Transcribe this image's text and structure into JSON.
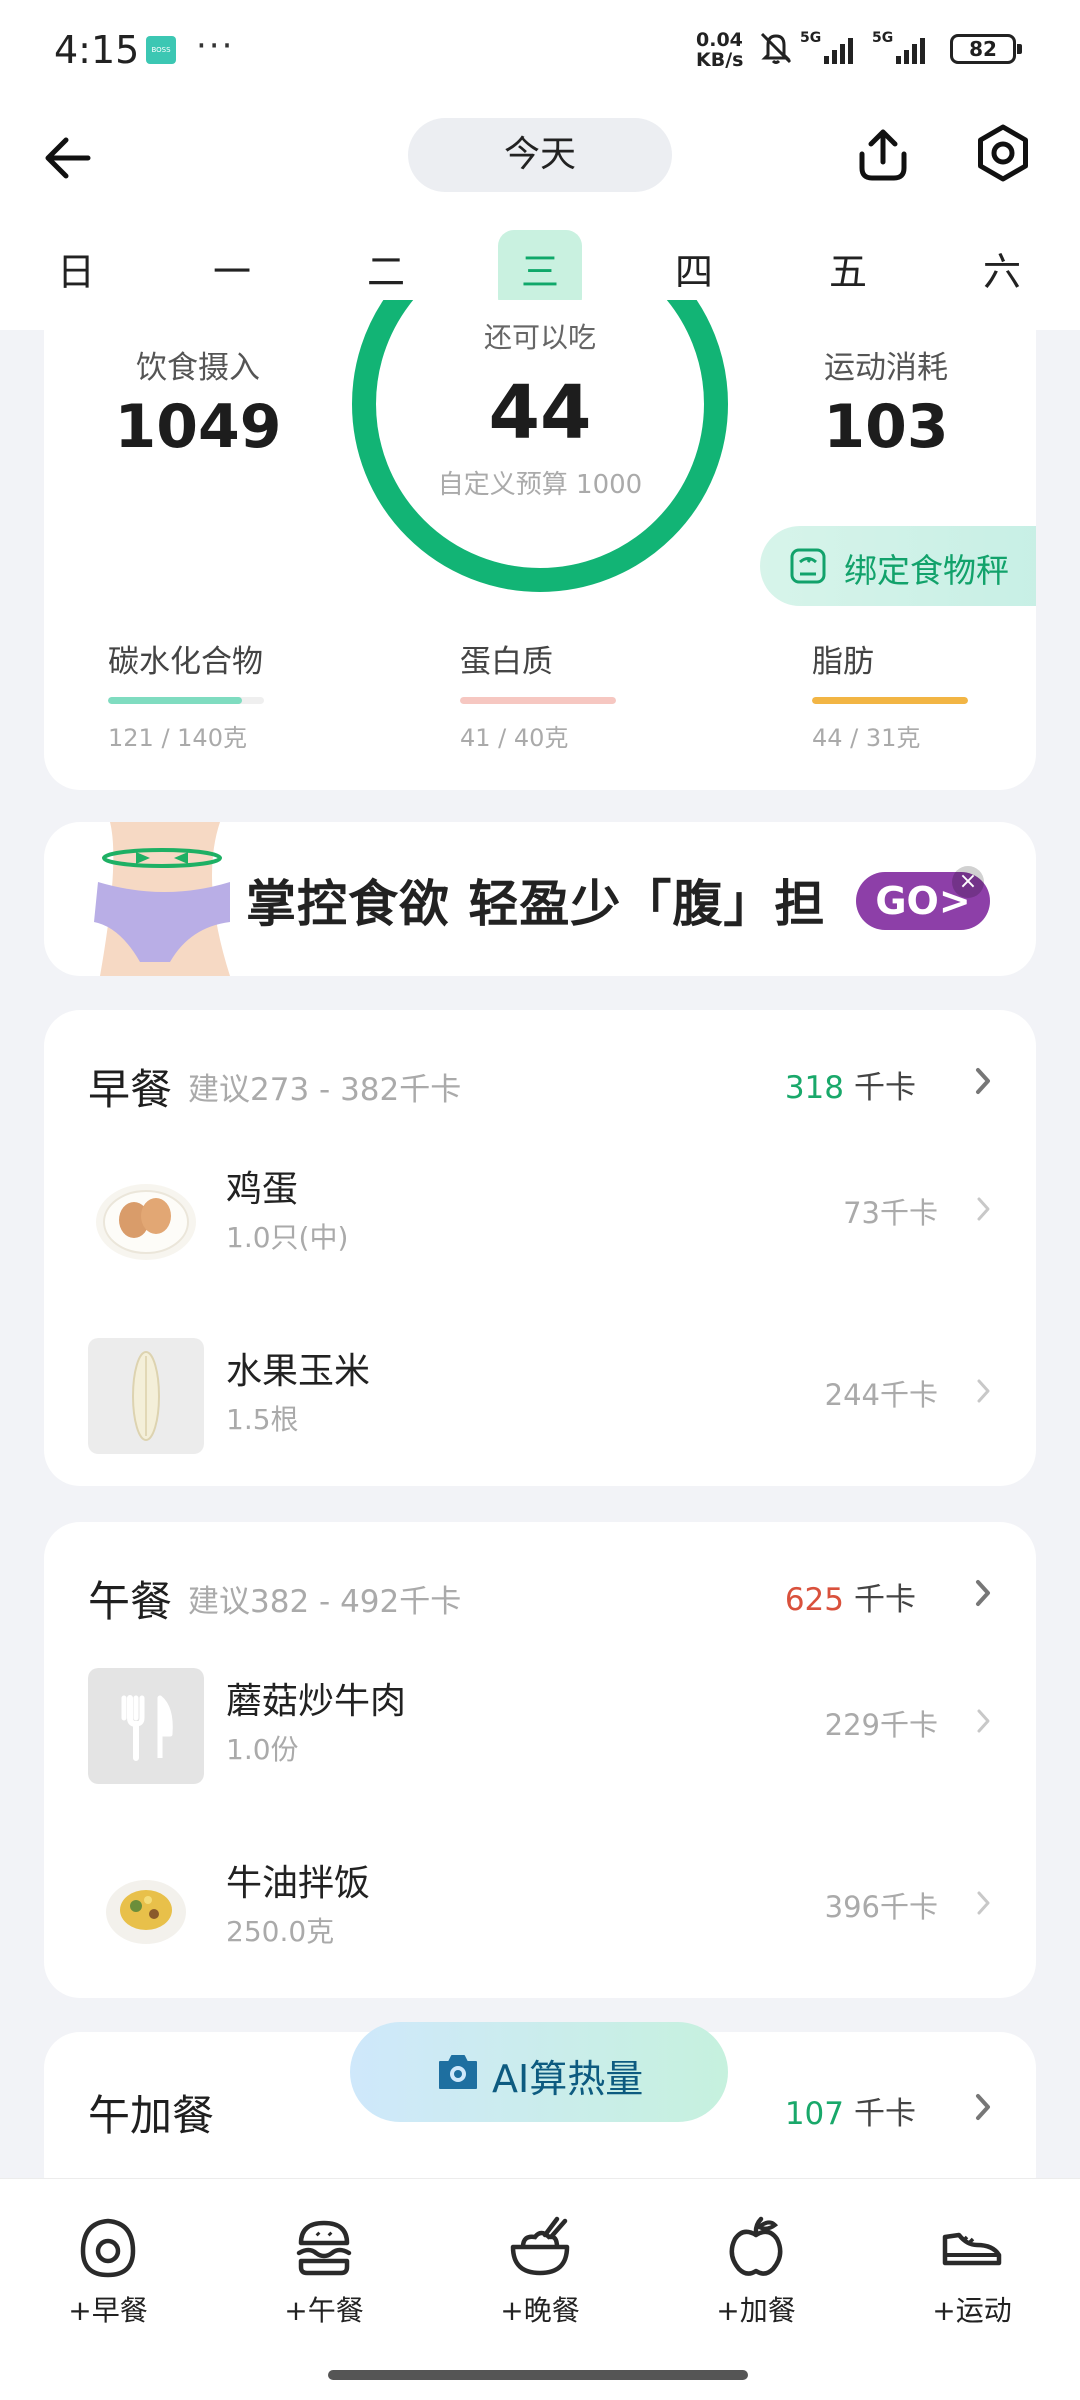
{
  "status_bar": {
    "time": "4:15",
    "app_badge": "BOSS",
    "more": "···",
    "net_speed_value": "0.04",
    "net_speed_unit": "KB/s",
    "sig1_label": "5G",
    "sig2_label": "5G",
    "battery": "82"
  },
  "header": {
    "date_pill": "今天",
    "weekdays": [
      "日",
      "一",
      "二",
      "三",
      "四",
      "五",
      "六"
    ],
    "active_weekday_index": 3
  },
  "summary": {
    "intake_label": "饮食摄入",
    "intake_value": "1049",
    "remaining_label": "还可以吃",
    "remaining_value": "44",
    "budget_label": "自定义预算 1000",
    "exercise_label": "运动消耗",
    "exercise_value": "103",
    "scale_button": "绑定食物秤",
    "ring_progress": 0.956,
    "macros": [
      {
        "name": "碳水化合物",
        "value": "121 / 140克",
        "progress": 0.86,
        "color": "#7fdcc0"
      },
      {
        "name": "蛋白质",
        "value": "41 / 40克",
        "progress": 1.0,
        "color": "#f6c7c1"
      },
      {
        "name": "脂肪",
        "value": "44 / 31克",
        "progress": 1.0,
        "color": "#f2b544"
      }
    ]
  },
  "banner": {
    "text": "掌控食欲 轻盈少「腹」担",
    "go_label": "GO>",
    "close": "×"
  },
  "meals": {
    "breakfast": {
      "title": "早餐",
      "suggest": "建议273 - 382千卡",
      "kcal": "318",
      "unit": "千卡",
      "foods": [
        {
          "name": "鸡蛋",
          "amount": "1.0只(中)",
          "kcal": "73千卡"
        },
        {
          "name": "水果玉米",
          "amount": "1.5根",
          "kcal": "244千卡"
        }
      ]
    },
    "lunch": {
      "title": "午餐",
      "suggest": "建议382 - 492千卡",
      "kcal": "625",
      "unit": "千卡",
      "foods": [
        {
          "name": "蘑菇炒牛肉",
          "amount": "1.0份",
          "kcal": "229千卡"
        },
        {
          "name": "牛油拌饭",
          "amount": "250.0克",
          "kcal": "396千卡"
        }
      ]
    },
    "afternoon_snack": {
      "title": "午加餐",
      "kcal": "107",
      "unit": "千卡"
    }
  },
  "ai_button": {
    "label": "AI算热量"
  },
  "bottom_nav": {
    "items": [
      {
        "label": "+早餐",
        "icon": "egg-icon"
      },
      {
        "label": "+午餐",
        "icon": "burger-icon"
      },
      {
        "label": "+晚餐",
        "icon": "bowl-icon"
      },
      {
        "label": "+加餐",
        "icon": "apple-icon"
      },
      {
        "label": "+运动",
        "icon": "shoe-icon"
      }
    ]
  },
  "colors": {
    "accent_green": "#12b475",
    "over_red": "#d9513c",
    "go_purple": "#8d3fa8"
  }
}
